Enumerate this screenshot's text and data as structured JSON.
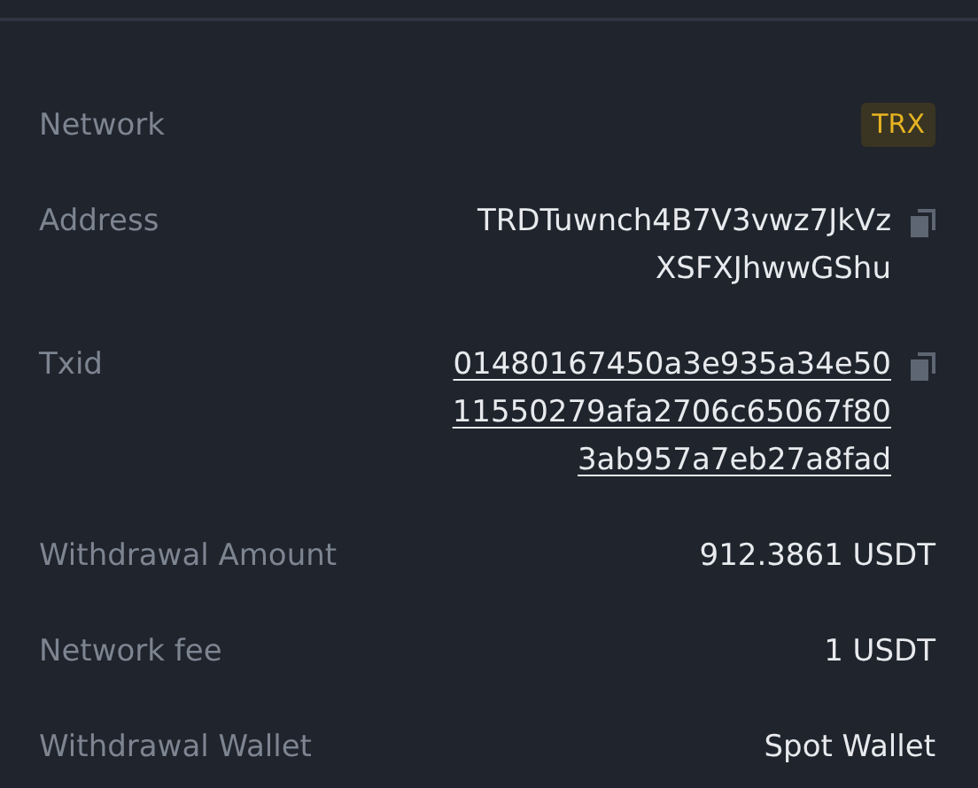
{
  "rows": [
    {
      "label": "Network",
      "kind": "badge",
      "value": "TRX",
      "copyable": false
    },
    {
      "label": "Address",
      "kind": "lines",
      "lines": [
        "TRDTuwnch4B7V3vwz7JkVz",
        "XSFXJhwwGShu"
      ],
      "copyable": true
    },
    {
      "label": "Txid",
      "kind": "link",
      "lines": [
        "01480167450a3e935a34e50",
        "11550279afa2706c65067f80",
        "3ab957a7eb27a8fad"
      ],
      "copyable": true
    },
    {
      "label": "Withdrawal Amount",
      "kind": "text",
      "value": "912.3861 USDT",
      "copyable": false
    },
    {
      "label": "Network fee",
      "kind": "text",
      "value": "1 USDT",
      "copyable": false
    },
    {
      "label": "Withdrawal Wallet",
      "kind": "text",
      "value": "Spot Wallet",
      "copyable": false
    }
  ]
}
